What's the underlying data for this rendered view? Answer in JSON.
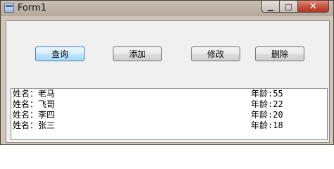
{
  "window": {
    "title": "Form1",
    "buttons": {
      "minimize": "▁",
      "maximize": "□",
      "close": "✕"
    }
  },
  "toolbar": {
    "query_label": "查询",
    "add_label": "添加",
    "edit_label": "修改",
    "delete_label": "删除"
  },
  "list": {
    "items": [
      {
        "name": "姓名：老马",
        "age": "年龄:55"
      },
      {
        "name": "姓名：飞哥",
        "age": "年龄:22"
      },
      {
        "name": "姓名：李四",
        "age": "年龄:20"
      },
      {
        "name": "姓名：张三",
        "age": "年龄:18"
      }
    ]
  },
  "colors": {
    "close_button": "#c65443",
    "focus_border": "#3c7fb1"
  }
}
